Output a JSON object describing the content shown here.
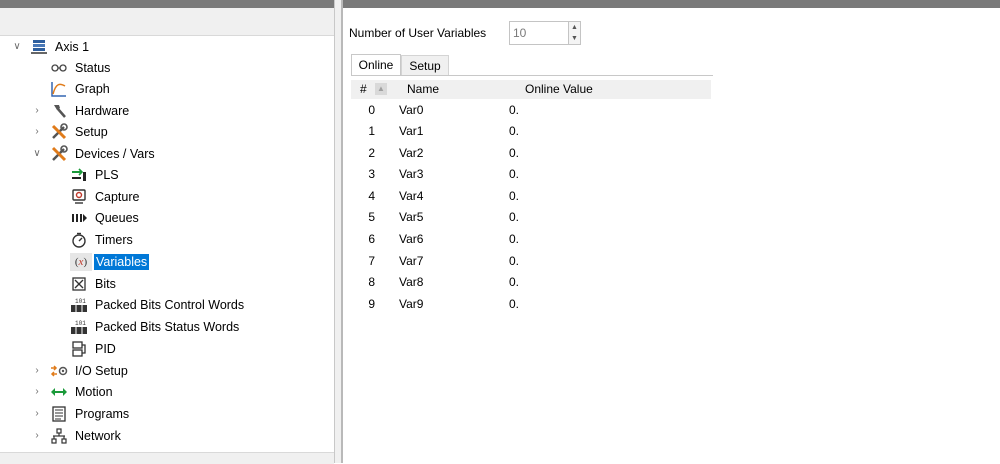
{
  "tree": {
    "items": [
      {
        "label": "Axis 1",
        "chevron": "v",
        "icon": "axis-icon"
      },
      {
        "label": "Status",
        "chevron": "",
        "icon": "status-icon"
      },
      {
        "label": "Graph",
        "chevron": "",
        "icon": "graph-icon"
      },
      {
        "label": "Hardware",
        "chevron": ">",
        "icon": "hardware-icon"
      },
      {
        "label": "Setup",
        "chevron": ">",
        "icon": "setup-tools-icon"
      },
      {
        "label": "Devices / Vars",
        "chevron": "v",
        "icon": "devices-tools-icon"
      },
      {
        "label": "PLS",
        "chevron": "",
        "icon": "pls-icon"
      },
      {
        "label": "Capture",
        "chevron": "",
        "icon": "capture-icon"
      },
      {
        "label": "Queues",
        "chevron": "",
        "icon": "queues-icon"
      },
      {
        "label": "Timers",
        "chevron": "",
        "icon": "timer-icon"
      },
      {
        "label": "Variables",
        "chevron": "",
        "icon": "variables-icon",
        "selected": true
      },
      {
        "label": "Bits",
        "chevron": "",
        "icon": "bits-icon"
      },
      {
        "label": "Packed Bits Control Words",
        "chevron": "",
        "icon": "packed-bits-icon"
      },
      {
        "label": "Packed Bits Status Words",
        "chevron": "",
        "icon": "packed-bits-icon"
      },
      {
        "label": "PID",
        "chevron": "",
        "icon": "pid-icon"
      },
      {
        "label": "I/O Setup",
        "chevron": ">",
        "icon": "io-setup-icon"
      },
      {
        "label": "Motion",
        "chevron": ">",
        "icon": "motion-arrows-icon"
      },
      {
        "label": "Programs",
        "chevron": ">",
        "icon": "programs-icon"
      },
      {
        "label": "Network",
        "chevron": ">",
        "icon": "network-icon"
      }
    ]
  },
  "main": {
    "num_vars_label": "Number of User Variables",
    "num_vars_value": "10",
    "tabs": [
      {
        "label": "Online",
        "active": true
      },
      {
        "label": "Setup",
        "active": false
      }
    ],
    "columns": {
      "num": "#",
      "name": "Name",
      "value": "Online Value"
    },
    "rows": [
      {
        "num": "0",
        "name": "Var0",
        "value": "0."
      },
      {
        "num": "1",
        "name": "Var1",
        "value": "0."
      },
      {
        "num": "2",
        "name": "Var2",
        "value": "0."
      },
      {
        "num": "3",
        "name": "Var3",
        "value": "0."
      },
      {
        "num": "4",
        "name": "Var4",
        "value": "0."
      },
      {
        "num": "5",
        "name": "Var5",
        "value": "0."
      },
      {
        "num": "6",
        "name": "Var6",
        "value": "0."
      },
      {
        "num": "7",
        "name": "Var7",
        "value": "0."
      },
      {
        "num": "8",
        "name": "Var8",
        "value": "0."
      },
      {
        "num": "9",
        "name": "Var9",
        "value": "0."
      }
    ]
  },
  "colors": {
    "selection": "#0078d7",
    "title_bar": "#7a7a7a"
  }
}
